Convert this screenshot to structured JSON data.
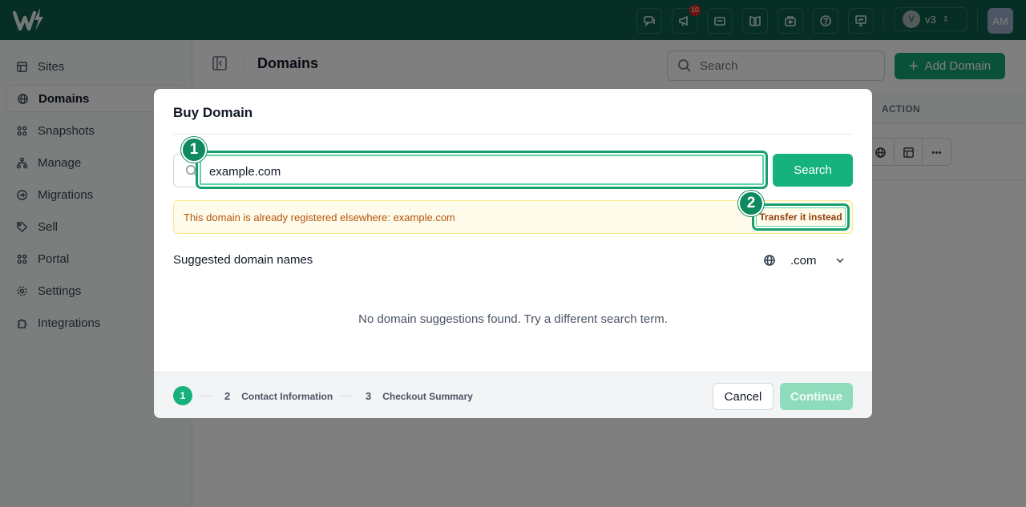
{
  "topbar": {
    "notification_count": "10",
    "version_avatar": "V",
    "version_label": "v3",
    "user_initials": "AM",
    "icons": [
      "chat-icon",
      "megaphone-icon",
      "ticket-icon",
      "book-icon",
      "store-icon",
      "help-icon",
      "presentation-icon"
    ]
  },
  "sidebar": {
    "items": [
      {
        "label": "Sites",
        "icon": "sites-icon"
      },
      {
        "label": "Domains",
        "icon": "globe-icon",
        "active": true
      },
      {
        "label": "Snapshots",
        "icon": "grid-icon"
      },
      {
        "label": "Manage",
        "icon": "tree-icon"
      },
      {
        "label": "Migrations",
        "icon": "arrow-circle-icon"
      },
      {
        "label": "Sell",
        "icon": "tag-icon"
      },
      {
        "label": "Portal",
        "icon": "grid-icon"
      },
      {
        "label": "Settings",
        "icon": "gear-icon"
      },
      {
        "label": "Integrations",
        "icon": "puzzle-icon"
      }
    ]
  },
  "main": {
    "title": "Domains",
    "search_placeholder": "Search",
    "add_domain_label": "Add Domain",
    "table_action_header": "ACTION"
  },
  "modal": {
    "title": "Buy Domain",
    "search_value": "example.com",
    "search_button": "Search",
    "alert_text": "This domain is already registered elsewhere: example.com",
    "transfer_button": "Transfer it instead",
    "suggested_label": "Suggested domain names",
    "tld_value": ".com",
    "empty_message": "No domain suggestions found. Try a different search term.",
    "markers": [
      "1",
      "2"
    ],
    "steps": [
      {
        "num": "1",
        "label": ""
      },
      {
        "num": "2",
        "label": "Contact Information"
      },
      {
        "num": "3",
        "label": "Checkout Summary"
      }
    ],
    "cancel_button": "Cancel",
    "continue_button": "Continue"
  },
  "colors": {
    "topbar": "#0f5c49",
    "accent": "#15b27d",
    "alert_bg": "#fffbeb",
    "alert_text": "#b45309"
  }
}
